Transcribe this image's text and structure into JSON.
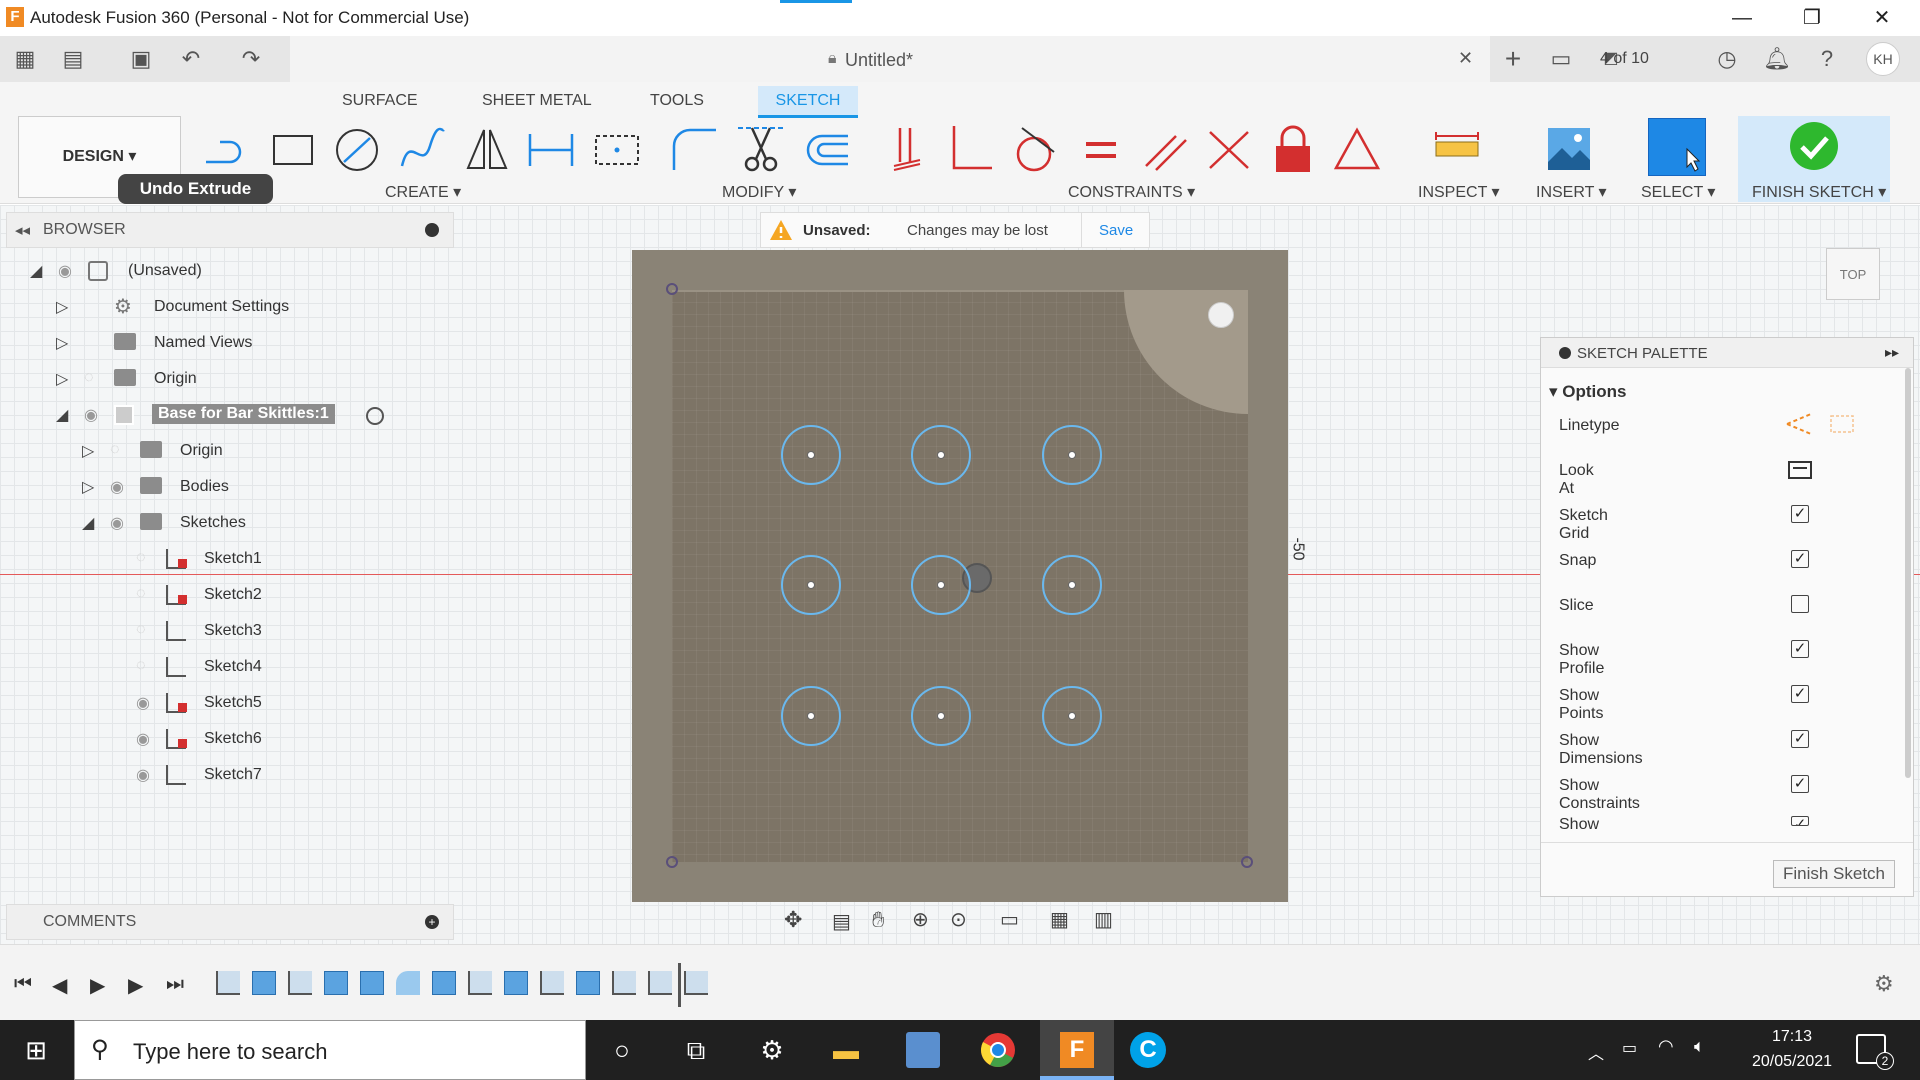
{
  "window": {
    "title": "Autodesk Fusion 360 (Personal - Not for Commercial Use)",
    "logo": "F",
    "minimize": "—",
    "restore": "❐",
    "close": "✕"
  },
  "appbar": {
    "doc_title": "Untitled*",
    "tab_count": "4 of 10",
    "avatar": "KH",
    "close_tab": "✕",
    "new_tab": "+"
  },
  "ribbon": {
    "tabs": [
      "SURFACE",
      "SHEET METAL",
      "TOOLS",
      "SKETCH"
    ],
    "workspace": "DESIGN ▾",
    "tooltip": "Undo Extrude",
    "groups": {
      "create": "CREATE ▾",
      "modify": "MODIFY ▾",
      "constraints": "CONSTRAINTS ▾",
      "inspect": "INSPECT ▾",
      "insert": "INSERT ▾",
      "select": "SELECT ▾",
      "finish": "FINISH SKETCH ▾"
    }
  },
  "unsaved": {
    "label": "Unsaved:",
    "message": "Changes may be lost",
    "save": "Save"
  },
  "browser": {
    "title": "BROWSER",
    "items": [
      {
        "label": "(Unsaved)"
      },
      {
        "label": "Document Settings"
      },
      {
        "label": "Named Views"
      },
      {
        "label": "Origin"
      },
      {
        "label": "Base for Bar Skittles:1"
      },
      {
        "label": "Origin"
      },
      {
        "label": "Bodies"
      },
      {
        "label": "Sketches"
      },
      {
        "label": "Sketch1"
      },
      {
        "label": "Sketch2"
      },
      {
        "label": "Sketch3"
      },
      {
        "label": "Sketch4"
      },
      {
        "label": "Sketch5"
      },
      {
        "label": "Sketch6"
      },
      {
        "label": "Sketch7"
      }
    ]
  },
  "comments": {
    "title": "COMMENTS"
  },
  "viewport": {
    "dimension": "-50",
    "viewcube": "TOP"
  },
  "palette": {
    "title": "SKETCH PALETTE",
    "section": "Options",
    "rows": [
      {
        "label": "Linetype"
      },
      {
        "label": "Look At"
      },
      {
        "label": "Sketch Grid",
        "checked": "✓"
      },
      {
        "label": "Snap",
        "checked": "✓"
      },
      {
        "label": "Slice",
        "checked": ""
      },
      {
        "label": "Show Profile",
        "checked": "✓"
      },
      {
        "label": "Show Points",
        "checked": "✓"
      },
      {
        "label": "Show Dimensions",
        "checked": "✓"
      },
      {
        "label": "Show Constraints",
        "checked": "✓"
      },
      {
        "label": "Show Projected Geometries",
        "checked": "✓"
      }
    ],
    "finish_button": "Finish Sketch"
  },
  "taskbar": {
    "search_placeholder": "Type here to search",
    "time": "17:13",
    "date": "20/05/2021",
    "notifications": "2"
  }
}
